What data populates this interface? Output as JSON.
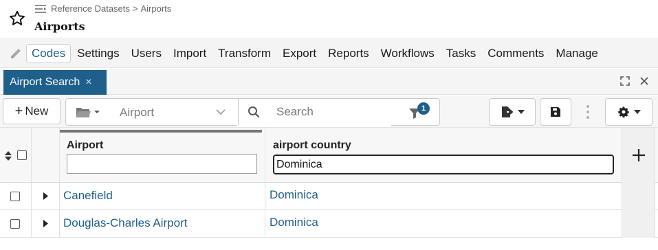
{
  "header": {
    "breadcrumb": [
      "Reference Datasets",
      "Airports"
    ],
    "breadcrumb_separator": ">",
    "title": "Airports"
  },
  "nav": {
    "tabs": [
      {
        "label": "Codes",
        "active": true
      },
      {
        "label": "Settings"
      },
      {
        "label": "Users"
      },
      {
        "label": "Import"
      },
      {
        "label": "Transform"
      },
      {
        "label": "Export"
      },
      {
        "label": "Reports"
      },
      {
        "label": "Workflows"
      },
      {
        "label": "Tasks"
      },
      {
        "label": "Comments"
      },
      {
        "label": "Manage"
      }
    ]
  },
  "doc_tab": {
    "label": "Airport Search",
    "close": "×"
  },
  "toolbar": {
    "new_label": "New",
    "dataset_value": "Airport",
    "search_placeholder": "Search",
    "filter_count": "1"
  },
  "grid": {
    "columns": [
      "Airport",
      "airport country"
    ],
    "filters": {
      "airport": "",
      "airport_country": "Dominica"
    },
    "rows": [
      {
        "airport": "Canefield",
        "country": "Dominica"
      },
      {
        "airport": "Douglas-Charles Airport",
        "country": "Dominica"
      }
    ]
  },
  "colors": {
    "accent": "#1f5f8b",
    "link": "#1f5f8b"
  }
}
